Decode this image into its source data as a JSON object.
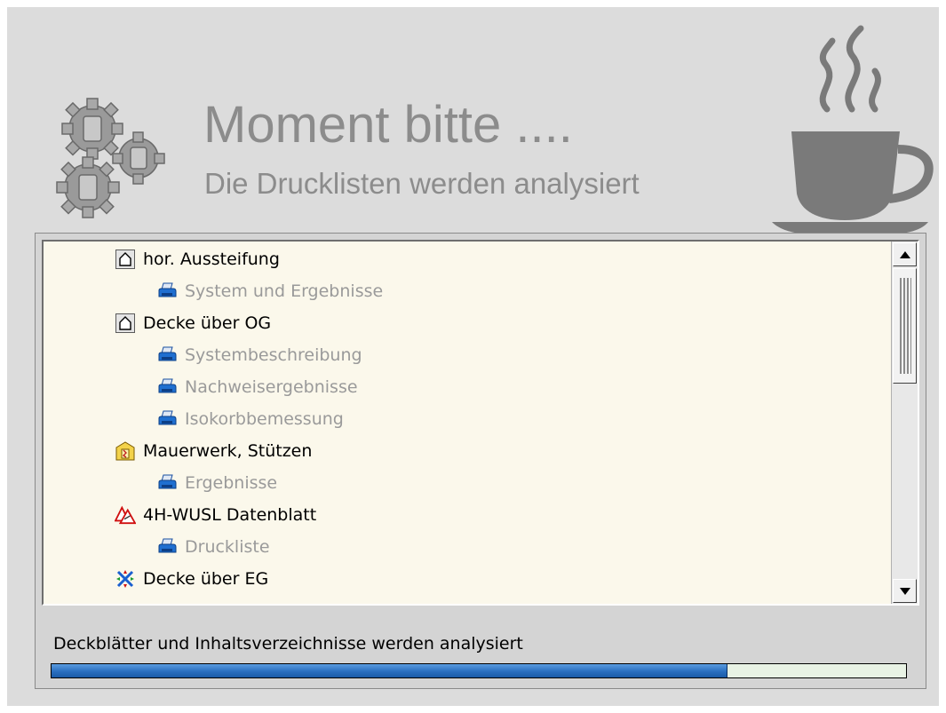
{
  "header": {
    "title": "Moment bitte ....",
    "subtitle": "Die Drucklisten werden analysiert"
  },
  "tree": {
    "items": [
      {
        "label": "hor. Aussteifung",
        "level": 1,
        "icon": "house-icon"
      },
      {
        "label": "System und Ergebnisse",
        "level": 2,
        "icon": "printer-icon"
      },
      {
        "label": "Decke über OG",
        "level": 1,
        "icon": "house-icon"
      },
      {
        "label": "Systembeschreibung",
        "level": 2,
        "icon": "printer-icon"
      },
      {
        "label": "Nachweisergebnisse",
        "level": 2,
        "icon": "printer-icon"
      },
      {
        "label": "Isokorbbemessung",
        "level": 2,
        "icon": "printer-icon"
      },
      {
        "label": "Mauerwerk, Stützen",
        "level": 1,
        "icon": "masonry-icon"
      },
      {
        "label": "Ergebnisse",
        "level": 2,
        "icon": "printer-icon"
      },
      {
        "label": "4H-WUSL Datenblatt",
        "level": 1,
        "icon": "warning-triangle-icon"
      },
      {
        "label": "Druckliste",
        "level": 2,
        "icon": "printer-icon"
      },
      {
        "label": "Decke über EG",
        "level": 1,
        "icon": "arrows-cross-icon"
      }
    ]
  },
  "status": {
    "text": "Deckblätter und Inhaltsverzeichnisse werden analysiert",
    "progress": 0.79
  },
  "colors": {
    "background": "#dcdcdc",
    "list_background": "#fbf8eb",
    "progress_fill": "#2a6fc0",
    "disabled_text": "#9a9a9a"
  }
}
